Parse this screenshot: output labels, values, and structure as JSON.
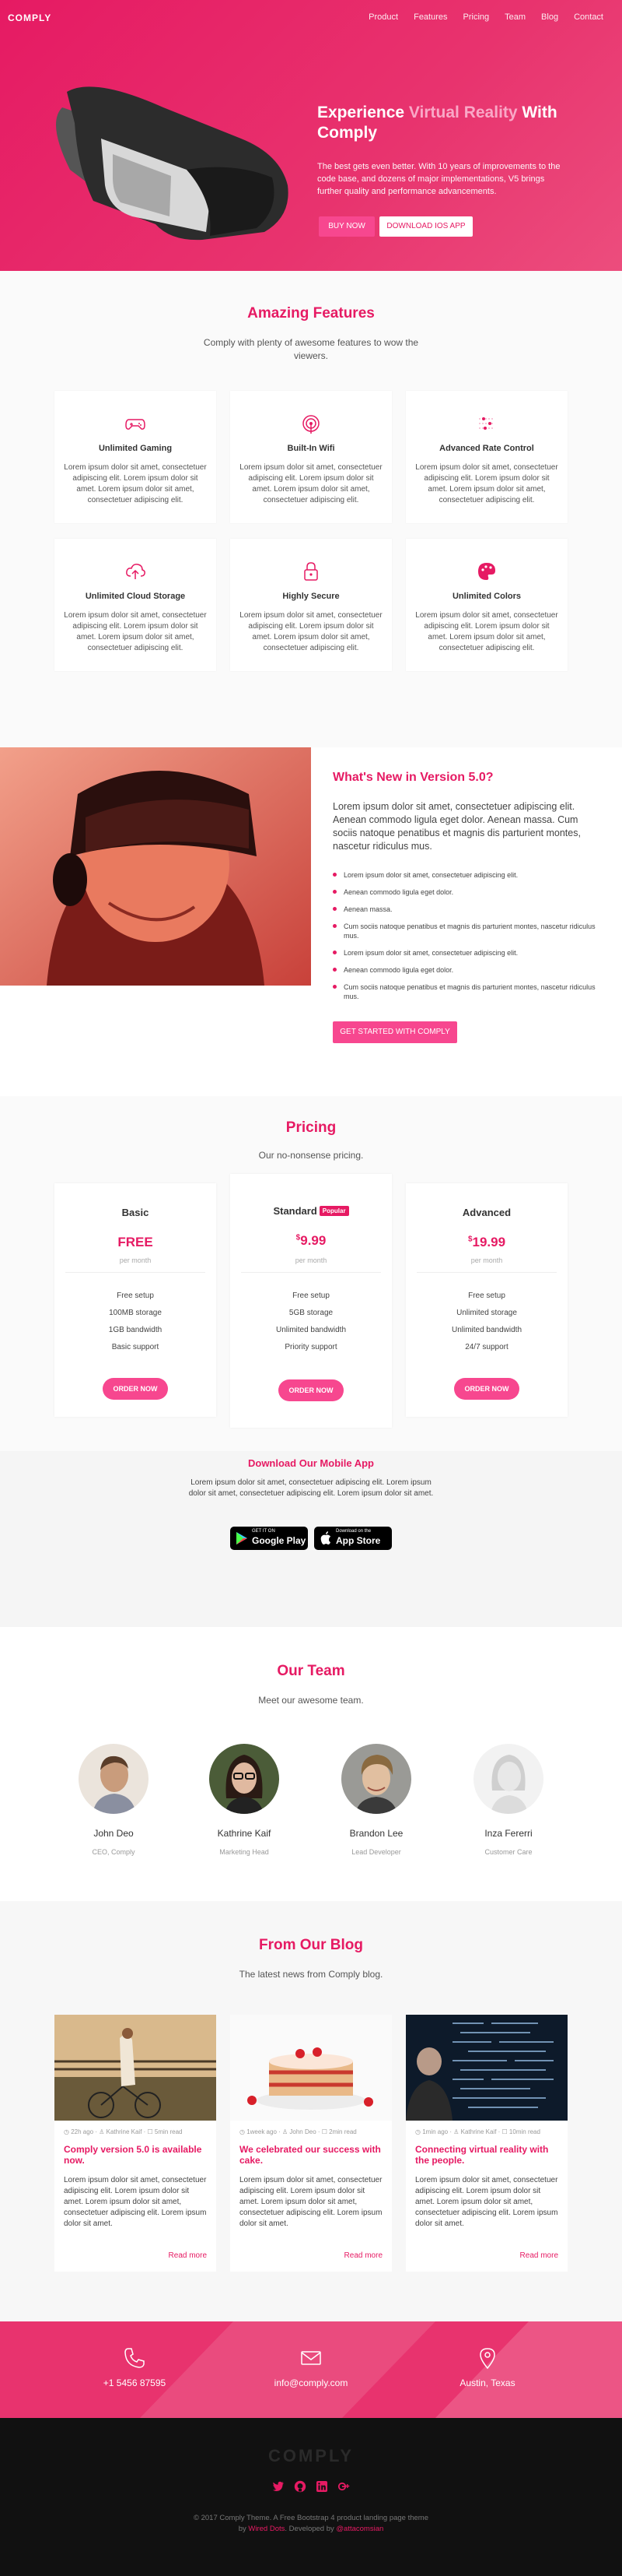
{
  "nav": {
    "brand": "COMPLY",
    "links": [
      "Product",
      "Features",
      "Pricing",
      "Team",
      "Blog",
      "Contact"
    ]
  },
  "hero": {
    "title_a": "Experience ",
    "title_hl": "Virtual Reality",
    "title_b": " With Comply",
    "text": "The best gets even better. With 10 years of improvements to the code base, and dozens of major implementations, V5 brings further quality and performance advancements.",
    "btn_buy": "BUY NOW",
    "btn_download": "DOWNLOAD IOS APP"
  },
  "features": {
    "title": "Amazing Features",
    "subtitle": "Comply with plenty of awesome features to wow the viewers.",
    "items": [
      {
        "title": "Unlimited Gaming",
        "text": "Lorem ipsum dolor sit amet, consectetuer adipiscing elit. Lorem ipsum dolor sit amet. Lorem ipsum dolor sit amet, consectetuer adipiscing elit.",
        "icon": "gamepad-icon"
      },
      {
        "title": "Built-In Wifi",
        "text": "Lorem ipsum dolor sit amet, consectetuer adipiscing elit. Lorem ipsum dolor sit amet. Lorem ipsum dolor sit amet, consectetuer adipiscing elit.",
        "icon": "wifi-icon"
      },
      {
        "title": "Advanced Rate Control",
        "text": "Lorem ipsum dolor sit amet, consectetuer adipiscing elit. Lorem ipsum dolor sit amet. Lorem ipsum dolor sit amet, consectetuer adipiscing elit.",
        "icon": "rate-control-icon"
      },
      {
        "title": "Unlimited Cloud Storage",
        "text": "Lorem ipsum dolor sit amet, consectetuer adipiscing elit. Lorem ipsum dolor sit amet. Lorem ipsum dolor sit amet, consectetuer adipiscing elit.",
        "icon": "cloud-upload-icon"
      },
      {
        "title": "Highly Secure",
        "text": "Lorem ipsum dolor sit amet, consectetuer adipiscing elit. Lorem ipsum dolor sit amet. Lorem ipsum dolor sit amet, consectetuer adipiscing elit.",
        "icon": "lock-icon"
      },
      {
        "title": "Unlimited Colors",
        "text": "Lorem ipsum dolor sit amet, consectetuer adipiscing elit. Lorem ipsum dolor sit amet. Lorem ipsum dolor sit amet, consectetuer adipiscing elit.",
        "icon": "palette-icon"
      }
    ]
  },
  "version": {
    "title": "What's New in Version 5.0?",
    "lead": "Lorem ipsum dolor sit amet, consectetuer adipiscing elit. Aenean commodo ligula eget dolor. Aenean massa. Cum sociis natoque penatibus et magnis dis parturient montes, nascetur ridiculus mus.",
    "bullets": [
      "Lorem ipsum dolor sit amet, consectetuer adipiscing elit.",
      "Aenean commodo ligula eget dolor.",
      "Aenean massa.",
      "Cum sociis natoque penatibus et magnis dis parturient montes, nascetur ridiculus mus.",
      "Lorem ipsum dolor sit amet, consectetuer adipiscing elit.",
      "Aenean commodo ligula eget dolor.",
      "Cum sociis natoque penatibus et magnis dis parturient montes, nascetur ridiculus mus."
    ],
    "btn": "GET STARTED WITH COMPLY"
  },
  "pricing": {
    "title": "Pricing",
    "subtitle": "Our no-nonsense pricing.",
    "per": "per month",
    "order": "ORDER NOW",
    "tag": "Popular",
    "plans": [
      {
        "name": "Basic",
        "price": "FREE",
        "currency": "",
        "features": [
          "Free setup",
          "100MB storage",
          "1GB bandwidth",
          "Basic support"
        ]
      },
      {
        "name": "Standard",
        "price": "9.99",
        "currency": "$",
        "features": [
          "Free setup",
          "5GB storage",
          "Unlimited bandwidth",
          "Priority support"
        ]
      },
      {
        "name": "Advanced",
        "price": "19.99",
        "currency": "$",
        "features": [
          "Free setup",
          "Unlimited storage",
          "Unlimited bandwidth",
          "24/7 support"
        ]
      }
    ]
  },
  "app": {
    "title": "Download Our Mobile App",
    "text": "Lorem ipsum dolor sit amet, consectetuer adipiscing elit. Lorem ipsum dolor sit amet, consectetuer adipiscing elit. Lorem ipsum dolor sit amet.",
    "google_small": "GET IT ON",
    "google": "Google Play",
    "apple_small": "Download on the",
    "apple": "App Store"
  },
  "team": {
    "title": "Our Team",
    "subtitle": "Meet our awesome team.",
    "members": [
      {
        "name": "John Deo",
        "role": "CEO, Comply"
      },
      {
        "name": "Kathrine Kaif",
        "role": "Marketing Head"
      },
      {
        "name": "Brandon Lee",
        "role": "Lead Developer"
      },
      {
        "name": "Inza Fererri",
        "role": "Customer Care"
      }
    ]
  },
  "blog": {
    "title": "From Our Blog",
    "subtitle": "The latest news from Comply blog.",
    "read_more": "Read more",
    "posts": [
      {
        "meta": "◷ 22h ago  ·  ♙ Kathrine Kaif  ·  ☐ 5min read",
        "title": "Comply version 5.0 is available now.",
        "text": "Lorem ipsum dolor sit amet, consectetuer adipiscing elit. Lorem ipsum dolor sit amet. Lorem ipsum dolor sit amet, consectetuer adipiscing elit. Lorem ipsum dolor sit amet."
      },
      {
        "meta": "◷ 1week ago  ·  ♙ John Deo  ·  ☐ 2min read",
        "title": "We celebrated our success with cake.",
        "text": "Lorem ipsum dolor sit amet, consectetuer adipiscing elit. Lorem ipsum dolor sit amet. Lorem ipsum dolor sit amet, consectetuer adipiscing elit. Lorem ipsum dolor sit amet."
      },
      {
        "meta": "◷ 1min ago  ·  ♙ Kathrine Kaif  ·  ☐ 10min read",
        "title": "Connecting virtual reality with the people.",
        "text": "Lorem ipsum dolor sit amet, consectetuer adipiscing elit. Lorem ipsum dolor sit amet. Lorem ipsum dolor sit amet, consectetuer adipiscing elit. Lorem ipsum dolor sit amet."
      }
    ]
  },
  "contact": {
    "phone": "+1 5456 87595",
    "email": "info@comply.com",
    "location": "Austin, Texas"
  },
  "footer": {
    "logo": "COMPLY",
    "line1": "© 2017 Comply Theme. A Free Bootstrap 4 product landing page theme",
    "by": "by ",
    "author": "Wired Dots",
    "dev": ". Developed by ",
    "dev_name": "@attacomsian"
  },
  "colors": {
    "accent": "#e61a63",
    "button": "#f7478f",
    "footer": "#111111"
  }
}
